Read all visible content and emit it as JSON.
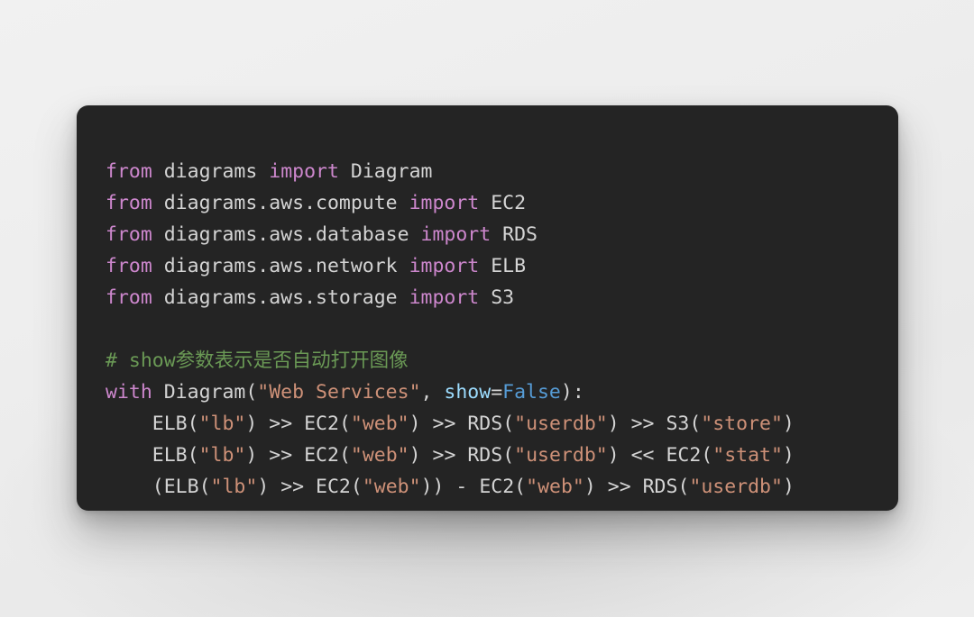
{
  "window": {
    "background_color": "#ececec",
    "card_background": "#242424"
  },
  "theme": {
    "keyword": "#cd87cd",
    "identifier": "#d4d4d4",
    "string": "#ce9178",
    "comment": "#6a9955",
    "parameter": "#9cdcfe",
    "constant": "#569cd6",
    "punctuation": "#d4d4d4"
  },
  "code": {
    "language": "python",
    "lines": [
      {
        "index": 1,
        "text": "from diagrams import Diagram",
        "tokens": [
          {
            "t": "from",
            "c": "keyword"
          },
          {
            "t": " ",
            "c": "punct"
          },
          {
            "t": "diagrams",
            "c": "name"
          },
          {
            "t": " ",
            "c": "punct"
          },
          {
            "t": "import",
            "c": "keyword"
          },
          {
            "t": " ",
            "c": "punct"
          },
          {
            "t": "Diagram",
            "c": "name"
          }
        ]
      },
      {
        "index": 2,
        "text": "from diagrams.aws.compute import EC2",
        "tokens": [
          {
            "t": "from",
            "c": "keyword"
          },
          {
            "t": " ",
            "c": "punct"
          },
          {
            "t": "diagrams.aws.compute",
            "c": "name"
          },
          {
            "t": " ",
            "c": "punct"
          },
          {
            "t": "import",
            "c": "keyword"
          },
          {
            "t": " ",
            "c": "punct"
          },
          {
            "t": "EC2",
            "c": "name"
          }
        ]
      },
      {
        "index": 3,
        "text": "from diagrams.aws.database import RDS",
        "tokens": [
          {
            "t": "from",
            "c": "keyword"
          },
          {
            "t": " ",
            "c": "punct"
          },
          {
            "t": "diagrams.aws.database",
            "c": "name"
          },
          {
            "t": " ",
            "c": "punct"
          },
          {
            "t": "import",
            "c": "keyword"
          },
          {
            "t": " ",
            "c": "punct"
          },
          {
            "t": "RDS",
            "c": "name"
          }
        ]
      },
      {
        "index": 4,
        "text": "from diagrams.aws.network import ELB",
        "tokens": [
          {
            "t": "from",
            "c": "keyword"
          },
          {
            "t": " ",
            "c": "punct"
          },
          {
            "t": "diagrams.aws.network",
            "c": "name"
          },
          {
            "t": " ",
            "c": "punct"
          },
          {
            "t": "import",
            "c": "keyword"
          },
          {
            "t": " ",
            "c": "punct"
          },
          {
            "t": "ELB",
            "c": "name"
          }
        ]
      },
      {
        "index": 5,
        "text": "from diagrams.aws.storage import S3",
        "tokens": [
          {
            "t": "from",
            "c": "keyword"
          },
          {
            "t": " ",
            "c": "punct"
          },
          {
            "t": "diagrams.aws.storage",
            "c": "name"
          },
          {
            "t": " ",
            "c": "punct"
          },
          {
            "t": "import",
            "c": "keyword"
          },
          {
            "t": " ",
            "c": "punct"
          },
          {
            "t": "S3",
            "c": "name"
          }
        ]
      },
      {
        "index": 6,
        "text": "",
        "tokens": []
      },
      {
        "index": 7,
        "text": "# show参数表示是否自动打开图像",
        "tokens": [
          {
            "t": "# show参数表示是否自动打开图像",
            "c": "comment"
          }
        ]
      },
      {
        "index": 8,
        "text": "with Diagram(\"Web Services\", show=False):",
        "tokens": [
          {
            "t": "with",
            "c": "keyword"
          },
          {
            "t": " ",
            "c": "punct"
          },
          {
            "t": "Diagram",
            "c": "name"
          },
          {
            "t": "(",
            "c": "punct"
          },
          {
            "t": "\"Web Services\"",
            "c": "string"
          },
          {
            "t": ", ",
            "c": "punct"
          },
          {
            "t": "show",
            "c": "param"
          },
          {
            "t": "=",
            "c": "op"
          },
          {
            "t": "False",
            "c": "const"
          },
          {
            "t": "):",
            "c": "punct"
          }
        ]
      },
      {
        "index": 9,
        "text": "    ELB(\"lb\") >> EC2(\"web\") >> RDS(\"userdb\") >> S3(\"store\")",
        "tokens": [
          {
            "t": "    ",
            "c": "punct"
          },
          {
            "t": "ELB",
            "c": "name"
          },
          {
            "t": "(",
            "c": "punct"
          },
          {
            "t": "\"lb\"",
            "c": "string"
          },
          {
            "t": ") ",
            "c": "punct"
          },
          {
            "t": ">>",
            "c": "op"
          },
          {
            "t": " ",
            "c": "punct"
          },
          {
            "t": "EC2",
            "c": "name"
          },
          {
            "t": "(",
            "c": "punct"
          },
          {
            "t": "\"web\"",
            "c": "string"
          },
          {
            "t": ") ",
            "c": "punct"
          },
          {
            "t": ">>",
            "c": "op"
          },
          {
            "t": " ",
            "c": "punct"
          },
          {
            "t": "RDS",
            "c": "name"
          },
          {
            "t": "(",
            "c": "punct"
          },
          {
            "t": "\"userdb\"",
            "c": "string"
          },
          {
            "t": ") ",
            "c": "punct"
          },
          {
            "t": ">>",
            "c": "op"
          },
          {
            "t": " ",
            "c": "punct"
          },
          {
            "t": "S3",
            "c": "name"
          },
          {
            "t": "(",
            "c": "punct"
          },
          {
            "t": "\"store\"",
            "c": "string"
          },
          {
            "t": ")",
            "c": "punct"
          }
        ]
      },
      {
        "index": 10,
        "text": "    ELB(\"lb\") >> EC2(\"web\") >> RDS(\"userdb\") << EC2(\"stat\")",
        "tokens": [
          {
            "t": "    ",
            "c": "punct"
          },
          {
            "t": "ELB",
            "c": "name"
          },
          {
            "t": "(",
            "c": "punct"
          },
          {
            "t": "\"lb\"",
            "c": "string"
          },
          {
            "t": ") ",
            "c": "punct"
          },
          {
            "t": ">>",
            "c": "op"
          },
          {
            "t": " ",
            "c": "punct"
          },
          {
            "t": "EC2",
            "c": "name"
          },
          {
            "t": "(",
            "c": "punct"
          },
          {
            "t": "\"web\"",
            "c": "string"
          },
          {
            "t": ") ",
            "c": "punct"
          },
          {
            "t": ">>",
            "c": "op"
          },
          {
            "t": " ",
            "c": "punct"
          },
          {
            "t": "RDS",
            "c": "name"
          },
          {
            "t": "(",
            "c": "punct"
          },
          {
            "t": "\"userdb\"",
            "c": "string"
          },
          {
            "t": ") ",
            "c": "punct"
          },
          {
            "t": "<<",
            "c": "op"
          },
          {
            "t": " ",
            "c": "punct"
          },
          {
            "t": "EC2",
            "c": "name"
          },
          {
            "t": "(",
            "c": "punct"
          },
          {
            "t": "\"stat\"",
            "c": "string"
          },
          {
            "t": ")",
            "c": "punct"
          }
        ]
      },
      {
        "index": 11,
        "text": "    (ELB(\"lb\") >> EC2(\"web\")) - EC2(\"web\") >> RDS(\"userdb\")",
        "tokens": [
          {
            "t": "    ",
            "c": "punct"
          },
          {
            "t": "(",
            "c": "punct"
          },
          {
            "t": "ELB",
            "c": "name"
          },
          {
            "t": "(",
            "c": "punct"
          },
          {
            "t": "\"lb\"",
            "c": "string"
          },
          {
            "t": ") ",
            "c": "punct"
          },
          {
            "t": ">>",
            "c": "op"
          },
          {
            "t": " ",
            "c": "punct"
          },
          {
            "t": "EC2",
            "c": "name"
          },
          {
            "t": "(",
            "c": "punct"
          },
          {
            "t": "\"web\"",
            "c": "string"
          },
          {
            "t": ")) ",
            "c": "punct"
          },
          {
            "t": "-",
            "c": "op"
          },
          {
            "t": " ",
            "c": "punct"
          },
          {
            "t": "EC2",
            "c": "name"
          },
          {
            "t": "(",
            "c": "punct"
          },
          {
            "t": "\"web\"",
            "c": "string"
          },
          {
            "t": ") ",
            "c": "punct"
          },
          {
            "t": ">>",
            "c": "op"
          },
          {
            "t": " ",
            "c": "punct"
          },
          {
            "t": "RDS",
            "c": "name"
          },
          {
            "t": "(",
            "c": "punct"
          },
          {
            "t": "\"userdb\"",
            "c": "string"
          },
          {
            "t": ")",
            "c": "punct"
          }
        ]
      }
    ]
  }
}
